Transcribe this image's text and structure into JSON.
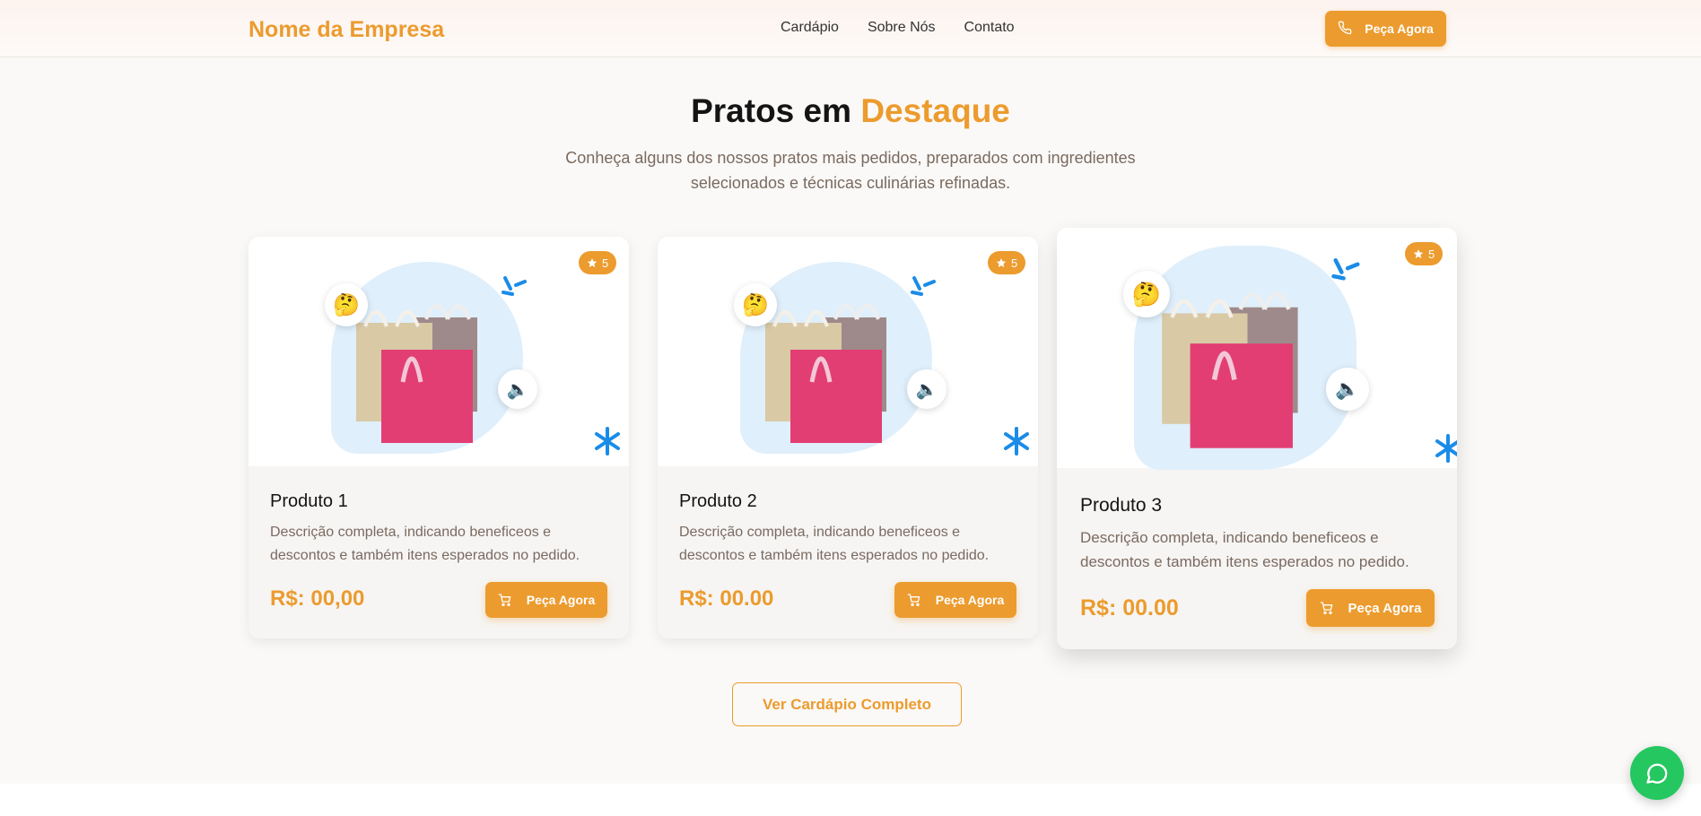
{
  "header": {
    "logo": "Nome da Empresa",
    "nav": [
      "Cardápio",
      "Sobre Nós",
      "Contato"
    ],
    "cta_label": "Peça Agora"
  },
  "hero": {
    "title_part1": "Pratos em",
    "title_accent": "Destaque",
    "subtitle": "Conheça alguns dos nossos pratos mais pedidos, preparados com ingredientes selecionados e técnicas culinárias refinadas."
  },
  "products": [
    {
      "name": "Produto 1",
      "description": "Descrição completa, indicando beneficeos e descontos e também itens esperados no pedido.",
      "price": "R$: 00,00",
      "rating": "5",
      "button_label": "Peça Agora"
    },
    {
      "name": "Produto 2",
      "description": "Descrição completa, indicando beneficeos e descontos e também itens esperados no pedido.",
      "price": "R$: 00.00",
      "rating": "5",
      "button_label": "Peça Agora"
    },
    {
      "name": "Produto 3",
      "description": "Descrição completa, indicando beneficeos e descontos e também itens esperados no pedido.",
      "price": "R$: 00.00",
      "rating": "5",
      "button_label": "Peça Agora"
    }
  ],
  "full_menu_label": "Ver Cardápio Completo",
  "colors": {
    "accent": "#ec9b2e",
    "whatsapp": "#25c760",
    "blob": "#dfeffb",
    "bag_pink": "#e23e74",
    "bag_beige": "#d9c9a5",
    "bag_mauve": "#9e8a8a"
  },
  "icons": {
    "phone": "phone-icon",
    "cart": "cart-icon",
    "star": "star-icon",
    "whatsapp": "whatsapp-icon",
    "thinking": "thinking-emoji-icon",
    "speaker": "speaker-emoji-icon"
  }
}
